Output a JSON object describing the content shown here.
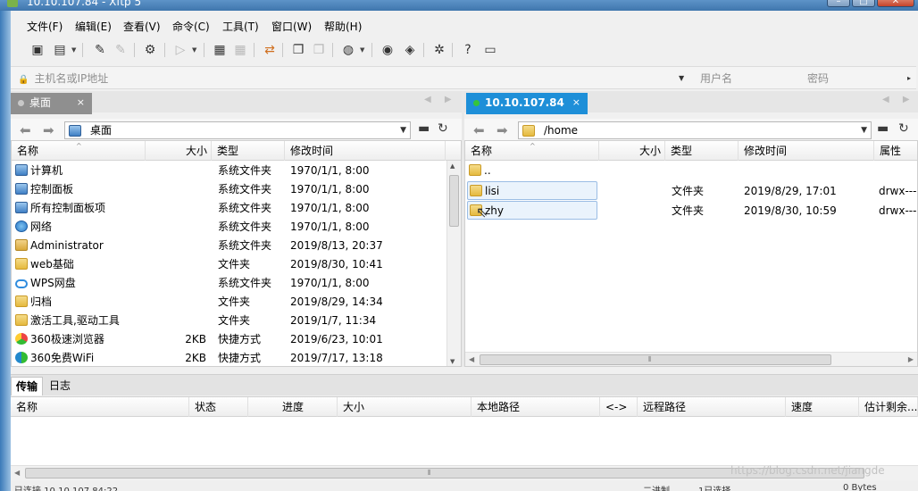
{
  "window": {
    "title": "10.10.107.84  - Xftp 5",
    "minimize_glyph": "–",
    "maximize_glyph": "□",
    "close_glyph": "✕"
  },
  "menu": [
    "文件(F)",
    "编辑(E)",
    "查看(V)",
    "命令(C)",
    "工具(T)",
    "窗口(W)",
    "帮助(H)"
  ],
  "toolbar_icons": [
    "new-session-icon",
    "open-folder-icon",
    "connect-icon",
    "disconnect-icon",
    "properties-icon",
    "transfer-icon",
    "new-file-icon",
    "new-document-icon",
    "sync-icon",
    "copy-icon",
    "paste-icon",
    "globe-icon",
    "xshell-icon",
    "xftp-icon",
    "settings-icon",
    "help-icon",
    "feedback-icon"
  ],
  "address": {
    "host_placeholder": "主机名或IP地址",
    "user_placeholder": "用户名",
    "password_placeholder": "密码"
  },
  "left_panel": {
    "tab_label": "桌面",
    "tab_close": "×",
    "path": "桌面",
    "columns": [
      "名称",
      "大小",
      "类型",
      "修改时间"
    ],
    "rows": [
      {
        "name": "计算机",
        "icon": "pc",
        "size": "",
        "type": "系统文件夹",
        "modified": "1970/1/1, 8:00"
      },
      {
        "name": "控制面板",
        "icon": "pc",
        "size": "",
        "type": "系统文件夹",
        "modified": "1970/1/1, 8:00"
      },
      {
        "name": "所有控制面板项",
        "icon": "pc",
        "size": "",
        "type": "系统文件夹",
        "modified": "1970/1/1, 8:00"
      },
      {
        "name": "网络",
        "icon": "net",
        "size": "",
        "type": "系统文件夹",
        "modified": "1970/1/1, 8:00"
      },
      {
        "name": "Administrator",
        "icon": "user",
        "size": "",
        "type": "系统文件夹",
        "modified": "2019/8/13, 20:37"
      },
      {
        "name": "web基础",
        "icon": "folder",
        "size": "",
        "type": "文件夹",
        "modified": "2019/8/30, 10:41"
      },
      {
        "name": "WPS网盘",
        "icon": "cloud",
        "size": "",
        "type": "系统文件夹",
        "modified": "1970/1/1, 8:00"
      },
      {
        "name": "归档",
        "icon": "folder",
        "size": "",
        "type": "文件夹",
        "modified": "2019/8/29, 14:34"
      },
      {
        "name": "激活工具,驱动工具",
        "icon": "folder",
        "size": "",
        "type": "文件夹",
        "modified": "2019/1/7, 11:34"
      },
      {
        "name": "360极速浏览器",
        "icon": "chrome",
        "size": "2KB",
        "type": "快捷方式",
        "modified": "2019/6/23, 10:01"
      },
      {
        "name": "360免费WiFi",
        "icon": "wifi",
        "size": "2KB",
        "type": "快捷方式",
        "modified": "2019/7/17, 13:18"
      }
    ]
  },
  "right_panel": {
    "tab_label": "10.10.107.84",
    "tab_close": "×",
    "path": "/home",
    "columns": [
      "名称",
      "大小",
      "类型",
      "修改时间",
      "属性"
    ],
    "rows": [
      {
        "name": "..",
        "size": "",
        "type": "",
        "modified": "",
        "attrs": ""
      },
      {
        "name": "lisi",
        "size": "",
        "type": "文件夹",
        "modified": "2019/8/29, 17:01",
        "attrs": "drwx---"
      },
      {
        "name": "zhy",
        "size": "",
        "type": "文件夹",
        "modified": "2019/8/30, 10:59",
        "attrs": "drwx---"
      }
    ]
  },
  "transfer": {
    "tabs": [
      "传输",
      "日志"
    ],
    "columns": [
      "名称",
      "状态",
      "进度",
      "大小",
      "本地路径",
      "<->",
      "远程路径",
      "速度",
      "估计剩余..."
    ]
  },
  "status": {
    "connection": "已连接 10.10.107.84:22。",
    "mode": "二进制",
    "selected": "1已选择",
    "bytes": "0 Bytes"
  },
  "watermark": "https://blog.csdn.net/jiangde"
}
